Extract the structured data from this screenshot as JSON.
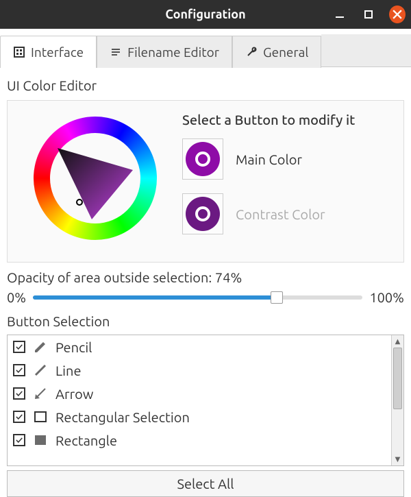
{
  "window": {
    "title": "Configuration"
  },
  "tabs": {
    "interface": "Interface",
    "filename_editor": "Filename Editor",
    "general": "General",
    "active": "Interface"
  },
  "color_editor": {
    "heading": "UI Color Editor",
    "hint": "Select a Button to modify it",
    "main_label": "Main Color",
    "contrast_label": "Contrast Color",
    "main_color": "#8e0ca7",
    "contrast_color": "#6b1982"
  },
  "opacity": {
    "label": "Opacity of area outside selection: 74%",
    "min_label": "0%",
    "max_label": "100%",
    "value_percent": 74
  },
  "button_selection": {
    "heading": "Button Selection",
    "items": [
      {
        "checked": true,
        "label": "Pencil",
        "icon": "pencil-icon"
      },
      {
        "checked": true,
        "label": "Line",
        "icon": "line-icon"
      },
      {
        "checked": true,
        "label": "Arrow",
        "icon": "arrow-icon"
      },
      {
        "checked": true,
        "label": "Rectangular Selection",
        "icon": "rect-outline-icon"
      },
      {
        "checked": true,
        "label": "Rectangle",
        "icon": "rect-fill-icon"
      }
    ],
    "select_all": "Select All"
  }
}
